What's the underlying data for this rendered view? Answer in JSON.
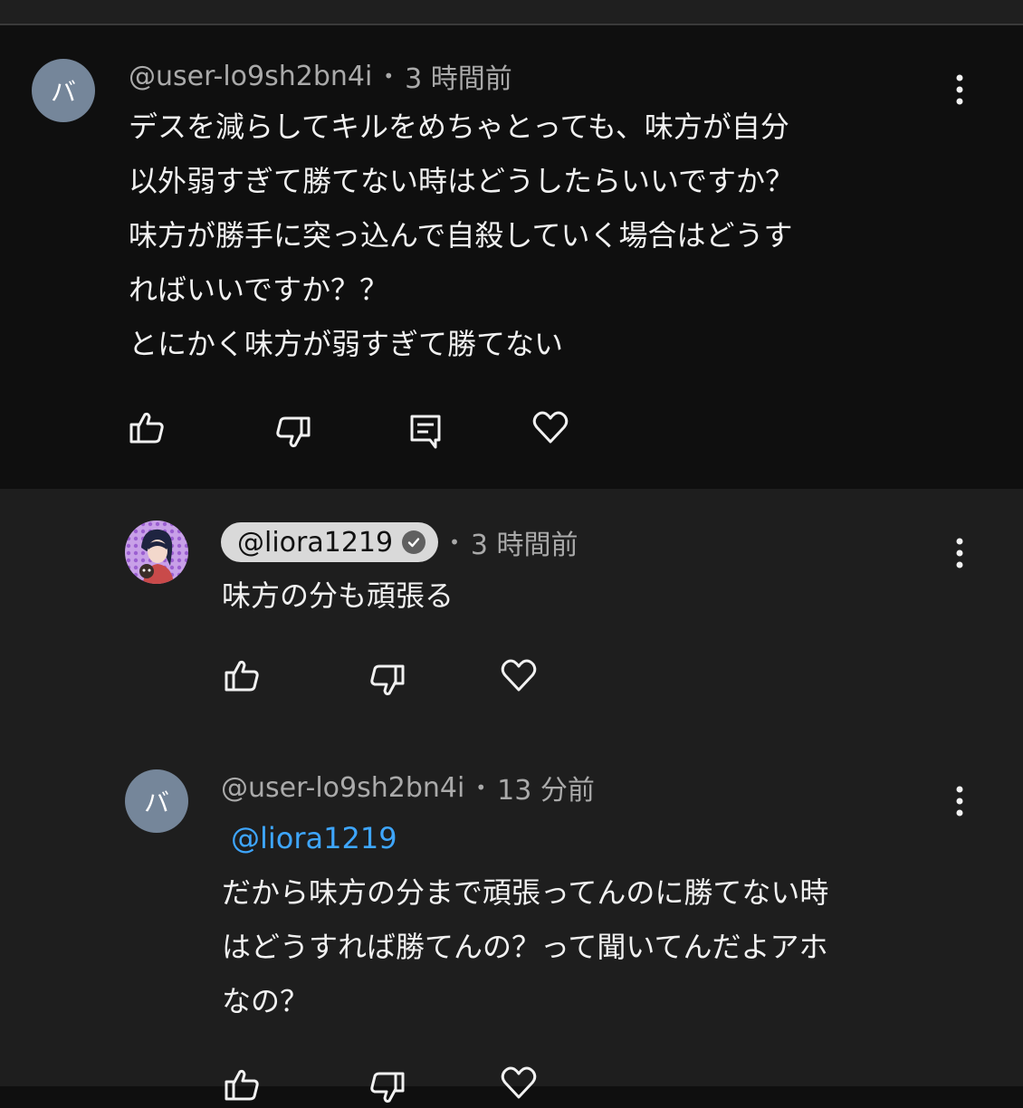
{
  "comments": [
    {
      "avatar_letter": "バ",
      "author": "@user-lo9sh2bn4i",
      "separator": "•",
      "time": "3 時間前",
      "lines": [
        "デスを減らしてキルをめちゃとっても、味方が自分",
        "以外弱すぎて勝てない時はどうしたらいいですか？",
        "味方が勝手に突っ込んで自殺していく場合はどうす",
        "ればいいですか？？",
        "とにかく味方が弱すぎて勝てない"
      ]
    }
  ],
  "replies": [
    {
      "author": "@liora1219",
      "verified": true,
      "separator": "•",
      "time": "3 時間前",
      "lines": [
        "味方の分も頑張る"
      ]
    },
    {
      "avatar_letter": "バ",
      "author": "@user-lo9sh2bn4i",
      "separator": "•",
      "time": "13 分前",
      "mention": "@liora1219",
      "lines": [
        "だから味方の分まで頑張ってんのに勝てない時",
        "はどうすれば勝てんの？って聞いてんだよアホ",
        "なの？"
      ]
    }
  ],
  "colors": {
    "background": "#0f0f0f",
    "reply_background": "#1e1e1e",
    "meta_text": "#aaaaaa",
    "mention": "#3ea6ff",
    "avatar": "#75869a"
  },
  "icons": [
    "like-icon",
    "dislike-icon",
    "reply-icon",
    "heart-icon",
    "more-vert-icon",
    "verified-check-icon"
  ]
}
